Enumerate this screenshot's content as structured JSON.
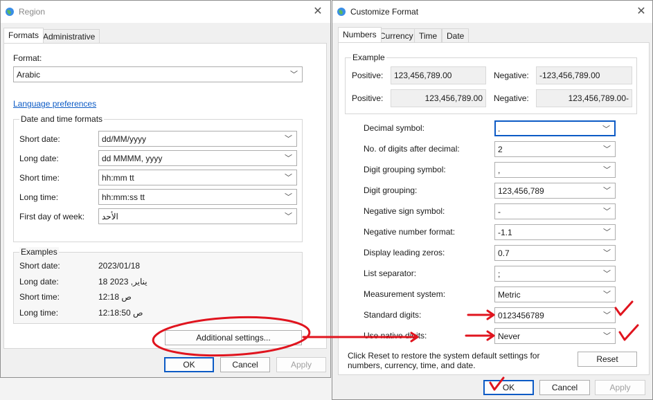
{
  "region": {
    "title": "Region",
    "close": "✕",
    "tabs": [
      "Formats",
      "Administrative"
    ],
    "format_label": "Format:",
    "format_value": "Arabic",
    "language_link": "Language preferences",
    "datetime_group": "Date and time formats",
    "rows": [
      {
        "label": "Short date:",
        "value": "dd/MM/yyyy"
      },
      {
        "label": "Long date:",
        "value": "dd MMMM, yyyy"
      },
      {
        "label": "Short time:",
        "value": "hh:mm tt"
      },
      {
        "label": "Long time:",
        "value": "hh:mm:ss tt"
      },
      {
        "label": "First day of week:",
        "value": "الأحد"
      }
    ],
    "examples_group": "Examples",
    "examples": [
      {
        "label": "Short date:",
        "value": "2023/01/18"
      },
      {
        "label": "Long date:",
        "value": "18 يناير, 2023"
      },
      {
        "label": "Short time:",
        "value": "12:18 ص"
      },
      {
        "label": "Long time:",
        "value": "12:18:50 ص"
      }
    ],
    "additional_settings": "Additional settings...",
    "ok": "OK",
    "cancel": "Cancel",
    "apply": "Apply"
  },
  "customize": {
    "title": "Customize Format",
    "close": "✕",
    "tabs": [
      "Numbers",
      "Currency",
      "Time",
      "Date"
    ],
    "example_group": "Example",
    "positive_label": "Positive:",
    "negative_label": "Negative:",
    "pos1": "123,456,789.00",
    "neg1": "-123,456,789.00",
    "pos2": "123,456,789.00",
    "neg2": "123,456,789.00-",
    "settings": [
      {
        "label": "Decimal symbol:",
        "value": "."
      },
      {
        "label": "No. of digits after decimal:",
        "value": "2"
      },
      {
        "label": "Digit grouping symbol:",
        "value": ","
      },
      {
        "label": "Digit grouping:",
        "value": "123,456,789"
      },
      {
        "label": "Negative sign symbol:",
        "value": "-"
      },
      {
        "label": "Negative number format:",
        "value": "-1.1"
      },
      {
        "label": "Display leading zeros:",
        "value": "0.7"
      },
      {
        "label": "List separator:",
        "value": ";"
      },
      {
        "label": "Measurement system:",
        "value": "Metric"
      },
      {
        "label": "Standard digits:",
        "value": "0123456789"
      },
      {
        "label": "Use native digits:",
        "value": "Never"
      }
    ],
    "reset_note": "Click Reset to restore the system default settings for numbers, currency, time, and date.",
    "reset": "Reset",
    "ok": "OK",
    "cancel": "Cancel",
    "apply": "Apply"
  },
  "colors": {
    "accent": "#0b5ac5",
    "annotation": "#e0141e"
  }
}
